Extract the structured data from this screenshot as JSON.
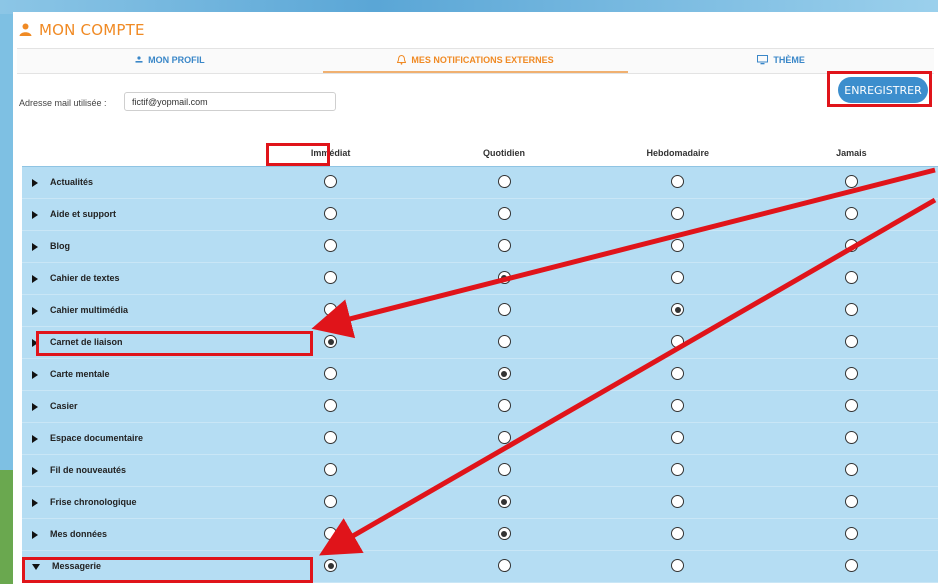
{
  "account": {
    "title": "MON COMPTE"
  },
  "tabs": [
    {
      "label": "MON PROFIL",
      "icon": "user-icon"
    },
    {
      "label": "MES NOTIFICATIONS EXTERNES",
      "icon": "bell-icon"
    },
    {
      "label": "THÈME",
      "icon": "monitor-icon"
    }
  ],
  "mail": {
    "label": "Adresse mail utilisée :",
    "value": "fictif@yopmail.com"
  },
  "save": {
    "label": "ENREGISTRER"
  },
  "columns": [
    "Immédiat",
    "Quotidien",
    "Hebdomadaire",
    "Jamais"
  ],
  "rows": [
    {
      "label": "Actualités",
      "selected": null,
      "expanded": false
    },
    {
      "label": "Aide et support",
      "selected": null,
      "expanded": false
    },
    {
      "label": "Blog",
      "selected": null,
      "expanded": false
    },
    {
      "label": "Cahier de textes",
      "selected": 1,
      "expanded": false
    },
    {
      "label": "Cahier multimédia",
      "selected": 2,
      "expanded": false
    },
    {
      "label": "Carnet de liaison",
      "selected": 0,
      "expanded": false
    },
    {
      "label": "Carte mentale",
      "selected": 1,
      "expanded": false
    },
    {
      "label": "Casier",
      "selected": null,
      "expanded": false
    },
    {
      "label": "Espace documentaire",
      "selected": null,
      "expanded": false
    },
    {
      "label": "Fil de nouveautés",
      "selected": null,
      "expanded": false
    },
    {
      "label": "Frise chronologique",
      "selected": 1,
      "expanded": false
    },
    {
      "label": "Mes données",
      "selected": 1,
      "expanded": false
    },
    {
      "label": "Messagerie",
      "selected": 0,
      "expanded": true
    }
  ],
  "colors": {
    "accent": "#f08a24",
    "link": "#3a87c8",
    "row_bg": "#b5ddf3",
    "annotation": "#e0141a",
    "button": "#3c8ecd"
  }
}
